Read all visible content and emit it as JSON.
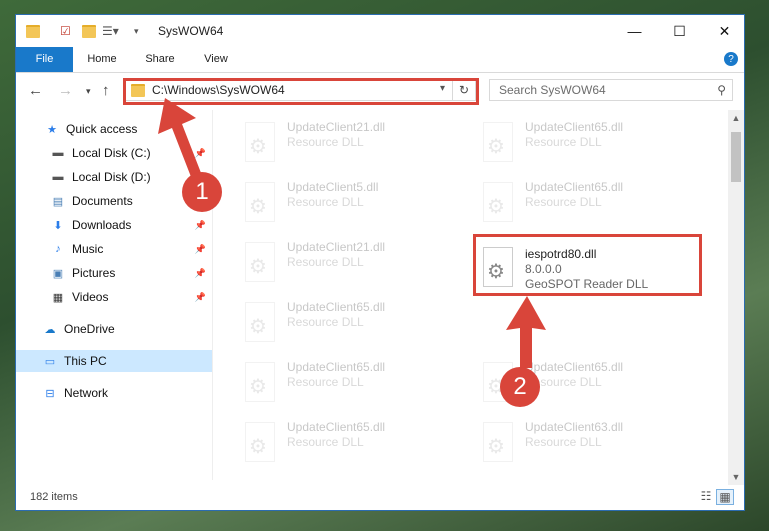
{
  "window": {
    "title": "SysWOW64"
  },
  "controls": {
    "minimize": "—",
    "maximize": "☐",
    "close": "✕"
  },
  "ribbon": {
    "tabs": [
      "File",
      "Home",
      "Share",
      "View"
    ]
  },
  "address": {
    "path": "C:\\Windows\\SysWOW64"
  },
  "search": {
    "placeholder": "Search SysWOW64"
  },
  "nav": {
    "items": [
      {
        "label": "Quick access",
        "icon": "star-icon"
      },
      {
        "label": "Local Disk (C:)",
        "icon": "drive-icon"
      },
      {
        "label": "Local Disk (D:)",
        "icon": "drive-icon"
      },
      {
        "label": "Documents",
        "icon": "documents-icon"
      },
      {
        "label": "Downloads",
        "icon": "download-icon"
      },
      {
        "label": "Music",
        "icon": "music-icon"
      },
      {
        "label": "Pictures",
        "icon": "pictures-icon"
      },
      {
        "label": "Videos",
        "icon": "videos-icon"
      },
      {
        "label": "OneDrive",
        "icon": "cloud-icon"
      },
      {
        "label": "This PC",
        "icon": "computer-icon"
      },
      {
        "label": "Network",
        "icon": "network-icon"
      }
    ]
  },
  "files": {
    "left": [
      {
        "name": "UpdateClient21.dll",
        "type": "Resource DLL"
      },
      {
        "name": "UpdateClient5.dll",
        "type": "Resource DLL"
      },
      {
        "name": "UpdateClient21.dll",
        "type": "Resource DLL"
      },
      {
        "name": "UpdateClient65.dll",
        "type": "Resource DLL"
      },
      {
        "name": "UpdateClient65.dll",
        "type": "Resource DLL"
      },
      {
        "name": "UpdateClient65.dll",
        "type": "Resource DLL"
      }
    ],
    "right": [
      {
        "name": "UpdateClient65.dll",
        "type": "Resource DLL"
      },
      {
        "name": "UpdateClient65.dll",
        "type": "Resource DLL"
      },
      {
        "name": "UpdateClient65.dll",
        "type": "Resource DLL"
      },
      {
        "name": "UpdateClient63.dll",
        "type": "Resource DLL"
      }
    ],
    "highlighted": {
      "name": "iespotrd80.dll",
      "version": "8.0.0.0",
      "description": "GeoSPOT Reader DLL"
    }
  },
  "status": {
    "count": "182 items"
  },
  "badges": {
    "one": "1",
    "two": "2"
  },
  "colors": {
    "accent": "#1979ca",
    "highlight": "#d9453a"
  }
}
